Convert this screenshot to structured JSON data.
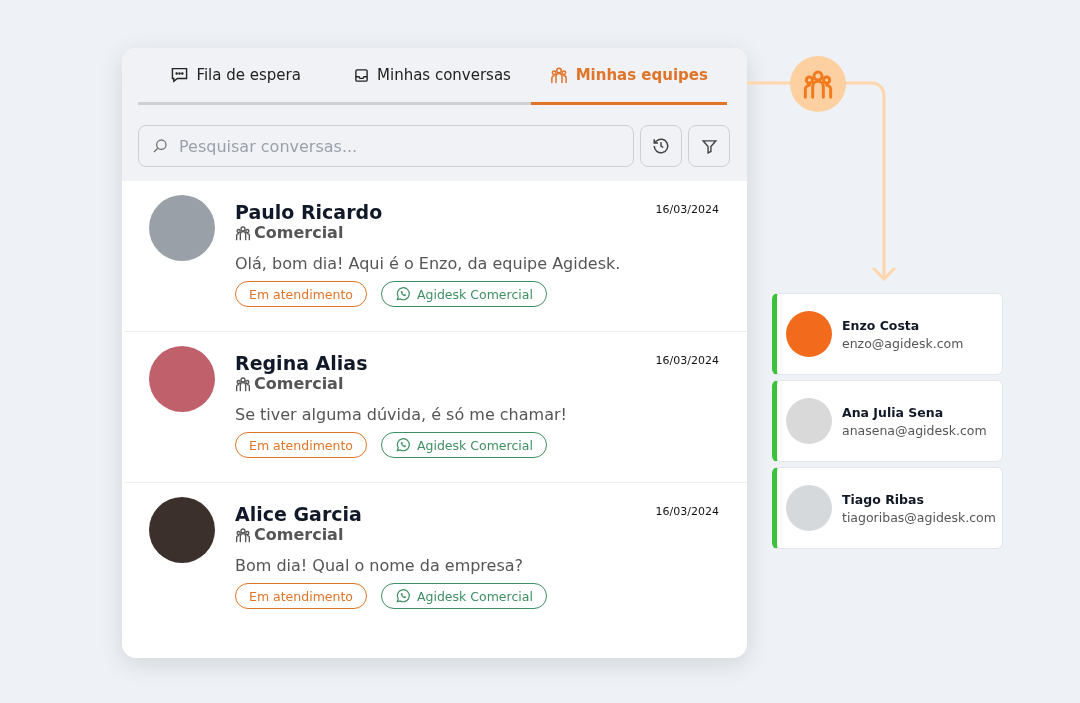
{
  "tabs": [
    {
      "label": "Fila de espera",
      "selected": false
    },
    {
      "label": "Minhas conversas",
      "selected": false
    },
    {
      "label": "Minhas equipes",
      "selected": true
    }
  ],
  "search": {
    "placeholder": "Pesquisar conversas..."
  },
  "conversations": [
    {
      "name": "Paulo Ricardo",
      "team": "Comercial",
      "date": "16/03/2024",
      "message": "Olá, bom dia! Aqui é o Enzo, da equipe Agidesk.",
      "status": "Em atendimento",
      "channel": "Agidesk Comercial"
    },
    {
      "name": "Regina Alias",
      "team": "Comercial",
      "date": "16/03/2024",
      "message": "Se tiver alguma dúvida, é só me chamar!",
      "status": "Em atendimento",
      "channel": "Agidesk Comercial"
    },
    {
      "name": "Alice Garcia",
      "team": "Comercial",
      "date": "16/03/2024",
      "message": "Bom dia! Qual o nome da empresa?",
      "status": "Em atendimento",
      "channel": "Agidesk Comercial"
    }
  ],
  "team_members": [
    {
      "name": "Enzo Costa",
      "email": "enzo@agidesk.com"
    },
    {
      "name": "Ana Julia Sena",
      "email": "anasena@agidesk.com"
    },
    {
      "name": "Tiago Ribas",
      "email": "tiagoribas@agidesk.com"
    }
  ]
}
